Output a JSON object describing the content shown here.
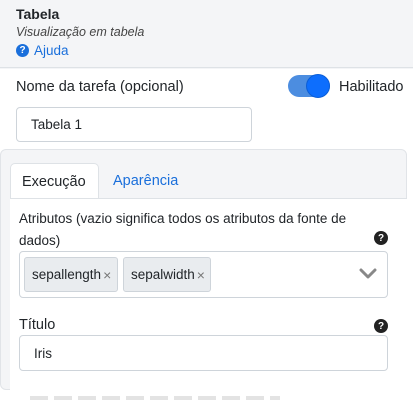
{
  "header": {
    "title": "Tabela",
    "subtitle": "Visualização em tabela",
    "help_label": "Ajuda"
  },
  "task": {
    "label": "Nome da tarefa (opcional)",
    "value": "Tabela 1",
    "toggle_label": "Habilitado",
    "toggle_on": true
  },
  "tabs": [
    {
      "label": "Execução",
      "active": true
    },
    {
      "label": "Aparência",
      "active": false
    }
  ],
  "attributes": {
    "label": "Atributos (vazio significa todos os atributos da fonte de dados)",
    "selected": [
      "sepallength",
      "sepalwidth"
    ]
  },
  "title_field": {
    "label": "Título",
    "value": "Iris"
  },
  "colors": {
    "accent": "#1a6fdb",
    "toggle": "#0d6efd",
    "panel_bg": "#f4f5f7"
  }
}
